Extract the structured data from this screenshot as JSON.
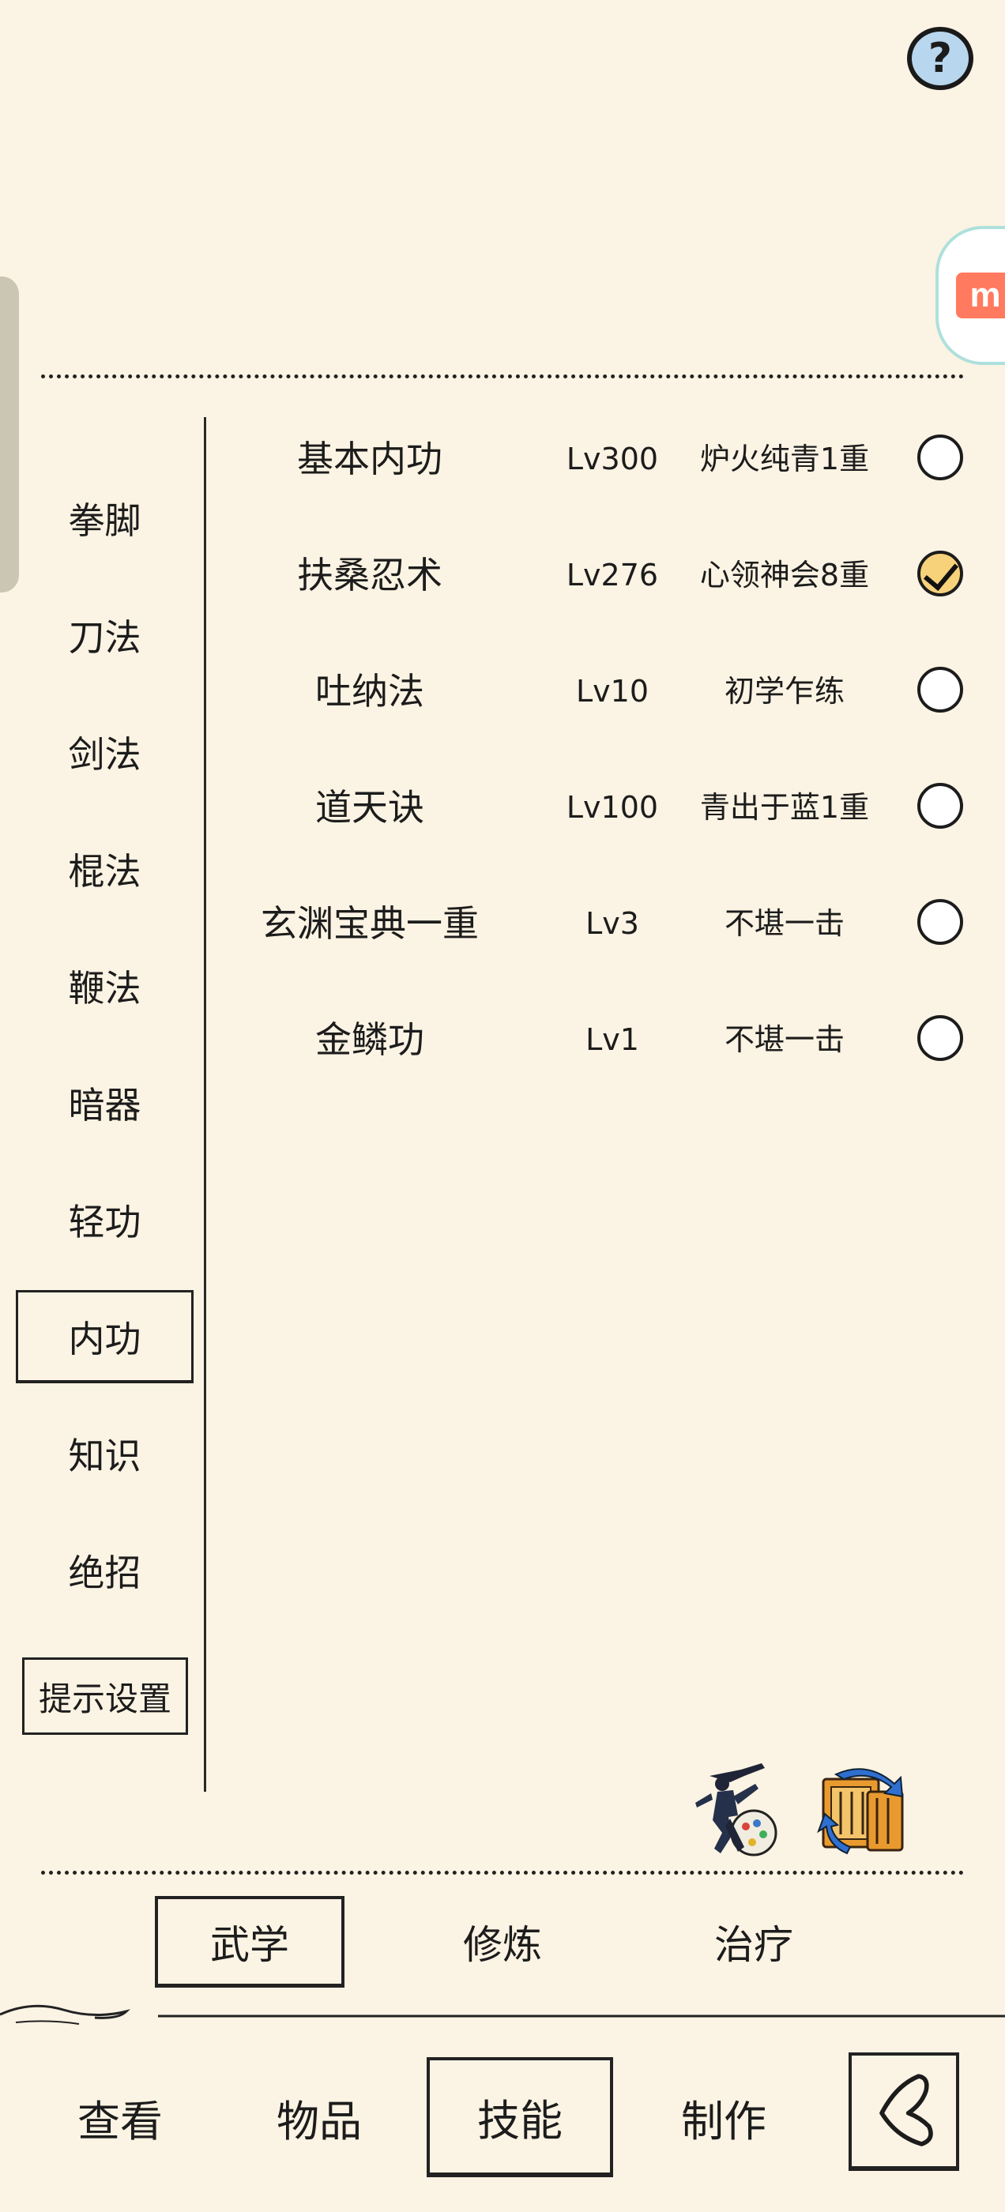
{
  "header": {
    "help_label": "?",
    "floating_badge_label": "m"
  },
  "categories": [
    {
      "label": "拳脚",
      "active": false
    },
    {
      "label": "刀法",
      "active": false
    },
    {
      "label": "剑法",
      "active": false
    },
    {
      "label": "棍法",
      "active": false
    },
    {
      "label": "鞭法",
      "active": false
    },
    {
      "label": "暗器",
      "active": false
    },
    {
      "label": "轻功",
      "active": false
    },
    {
      "label": "内功",
      "active": true
    },
    {
      "label": "知识",
      "active": false
    },
    {
      "label": "绝招",
      "active": false
    }
  ],
  "tips_button_label": "提示设置",
  "skills": [
    {
      "name": "基本内功",
      "level": "Lv300",
      "rank": "炉火纯青1重",
      "checked": false
    },
    {
      "name": "扶桑忍术",
      "level": "Lv276",
      "rank": "心领神会8重",
      "checked": true
    },
    {
      "name": "吐纳法",
      "level": "Lv10",
      "rank": "初学乍练",
      "checked": false
    },
    {
      "name": "道天诀",
      "level": "Lv100",
      "rank": "青出于蓝1重",
      "checked": false
    },
    {
      "name": "玄渊宝典一重",
      "level": "Lv3",
      "rank": "不堪一击",
      "checked": false
    },
    {
      "name": "金鳞功",
      "level": "Lv1",
      "rank": "不堪一击",
      "checked": false
    }
  ],
  "action_icons": [
    "martial-artist-icon",
    "scroll-switch-icon"
  ],
  "sub_tabs": [
    {
      "label": "武学",
      "active": true
    },
    {
      "label": "修炼",
      "active": false
    },
    {
      "label": "治疗",
      "active": false
    }
  ],
  "bottom_nav": [
    {
      "label": "查看",
      "active": false
    },
    {
      "label": "物品",
      "active": false
    },
    {
      "label": "技能",
      "active": true
    },
    {
      "label": "制作",
      "active": false
    }
  ],
  "colors": {
    "background": "#fbf3e3",
    "help_blue": "#b8d6ee",
    "checked_fill": "#f7d27a",
    "badge_orange": "#ff7a5e",
    "badge_ring": "#aee0dc"
  }
}
